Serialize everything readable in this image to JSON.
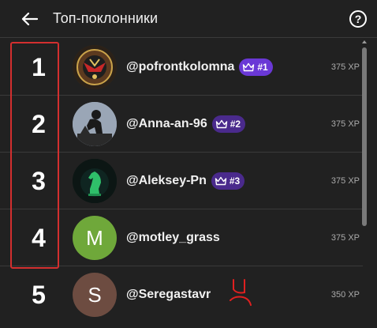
{
  "header": {
    "title": "Топ-поклонники",
    "help_label": "?"
  },
  "rows": [
    {
      "rank": "1",
      "username": "@pofrontkolomna",
      "badge": "#1",
      "xp": "375 XP"
    },
    {
      "rank": "2",
      "username": "@Anna-an-96",
      "badge": "#2",
      "xp": "375 XP"
    },
    {
      "rank": "3",
      "username": "@Aleksey-Pn",
      "badge": "#3",
      "xp": "375 XP"
    },
    {
      "rank": "4",
      "username": "@motley_grass",
      "avatar_letter": "M",
      "xp": "375 XP"
    },
    {
      "rank": "5",
      "username": "@Seregastavr",
      "avatar_letter": "S",
      "xp": "350 XP"
    }
  ],
  "colors": {
    "background": "#212121",
    "badge_1": "#6a38d6",
    "badge_2": "#4a2a8c",
    "badge_3": "#4a2a8c",
    "avatar_m": "#6fa83a",
    "avatar_s": "#6d4c41",
    "highlight": "#d32f2f"
  },
  "icons": {
    "back": "arrow-left-icon",
    "help": "help-circle-icon",
    "badge": "crown-icon"
  }
}
